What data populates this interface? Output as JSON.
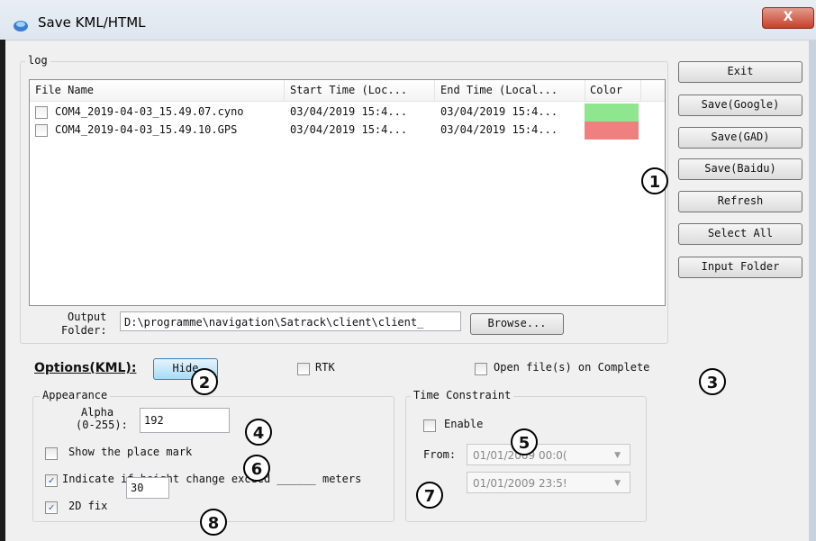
{
  "window": {
    "title": "Save KML/HTML",
    "close_glyph": "X"
  },
  "log": {
    "legend": "log",
    "columns": [
      "File Name",
      "Start Time (Loc...",
      "End Time (Local...",
      "Color"
    ],
    "rows": [
      {
        "file": "COM4_2019-04-03_15.49.07.cyno",
        "start": "03/04/2019 15:4...",
        "end": "03/04/2019 15:4...",
        "color": "#8ee68e",
        "checked": false
      },
      {
        "file": "COM4_2019-04-03_15.49.10.GPS",
        "start": "03/04/2019 15:4...",
        "end": "03/04/2019 15:4...",
        "color": "#f08080",
        "checked": false
      }
    ],
    "output_label_line1": "Output",
    "output_label_line2": "Folder:",
    "output_path": "D:\\programme\\navigation\\Satrack\\client\\client_",
    "browse_label": "Browse..."
  },
  "buttons": {
    "exit": "Exit",
    "save_google": "Save(Google)",
    "save_gad": "Save(GAD)",
    "save_baidu": "Save(Baidu)",
    "refresh": "Refresh",
    "select_all": "Select All",
    "input_folder": "Input Folder"
  },
  "options": {
    "label": "Options(KML):",
    "hide_label": "Hide",
    "rtk_label": "RTK",
    "open_files_label": "Open file(s) on Complete"
  },
  "appearance": {
    "legend": "Appearance",
    "alpha_label_line1": "Alpha",
    "alpha_label_line2": "(0-255):",
    "alpha_value": "192",
    "show_placemark_label": "Show the place mark",
    "indicate_label": "Indicate if height change exceed ______ meters",
    "height_value": "30",
    "fix2d_label": "2D fix"
  },
  "time": {
    "legend": "Time Constraint",
    "enable_label": "Enable",
    "from_label": "From:",
    "from_value": "01/01/2009  00:0(",
    "to_value": "01/01/2009  23:5!"
  },
  "callouts": [
    "1",
    "2",
    "3",
    "4",
    "5",
    "6",
    "7",
    "8"
  ]
}
